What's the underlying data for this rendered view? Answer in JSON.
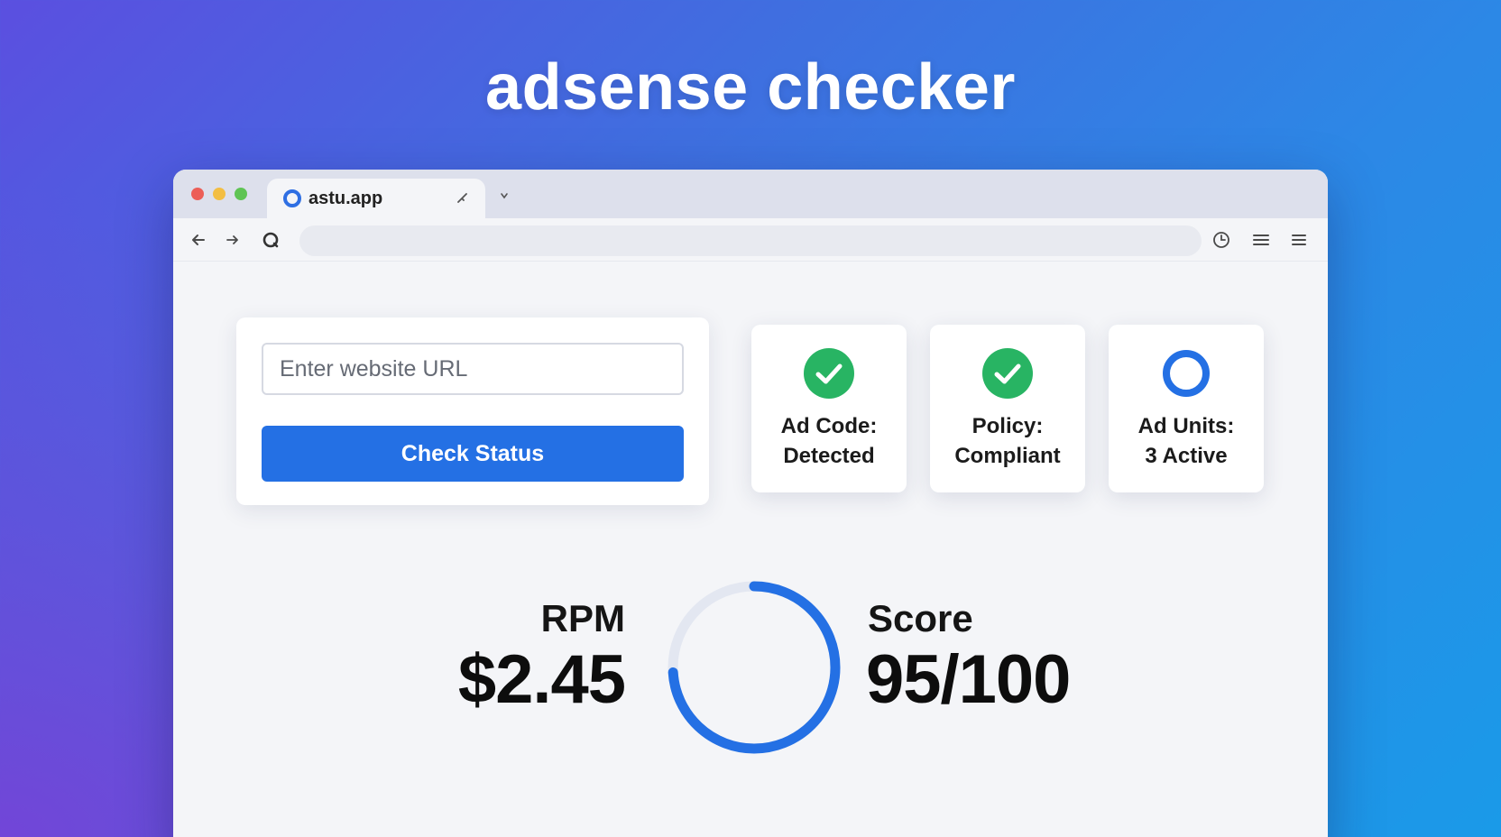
{
  "hero": {
    "title": "adsense checker"
  },
  "browser": {
    "tab": {
      "title": "astu.app",
      "close_icon": "pin-icon",
      "new_tab_icon": "new-tab-icon"
    },
    "address_value": ""
  },
  "checker": {
    "url_placeholder": "Enter website URL",
    "url_value": "",
    "button_label": "Check Status"
  },
  "status_cards": [
    {
      "label_line1": "Ad Code:",
      "label_line2": "Detected",
      "icon": "check-circle-icon",
      "color": "#28b463"
    },
    {
      "label_line1": "Policy:",
      "label_line2": "Compliant",
      "icon": "check-circle-icon",
      "color": "#28b463"
    },
    {
      "label_line1": "Ad Units:",
      "label_line2": "3 Active",
      "icon": "ring-icon",
      "color": "#2470e4"
    }
  ],
  "metrics": {
    "rpm_label": "RPM",
    "rpm_value": "$2.45",
    "score_label": "Score",
    "score_value": "95/100",
    "score_fraction": 0.95
  },
  "colors": {
    "accent": "#2470e4",
    "success": "#28b463",
    "ring_track": "#e3e7f1"
  }
}
